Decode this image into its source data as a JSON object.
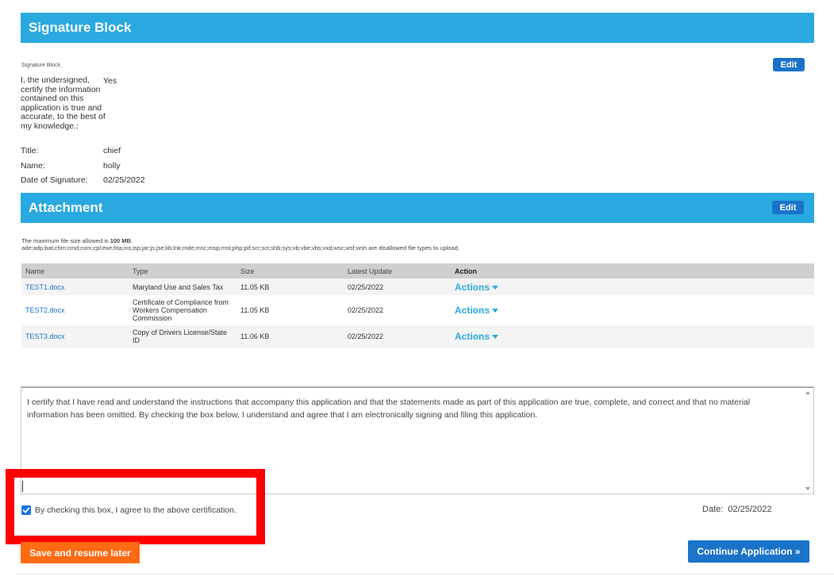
{
  "signature_block": {
    "header": "Signature Block",
    "edit_label": "Edit",
    "small_label": "Signature Block",
    "certify_question": "I, the undersigned, certify the information contained on this application is true and accurate, to the best of my knowledge.:",
    "certify_answer": "Yes",
    "fields": [
      {
        "label": "Title:",
        "value": "chief"
      },
      {
        "label": "Name:",
        "value": "holly"
      },
      {
        "label": "Date of Signature:",
        "value": "02/25/2022"
      }
    ]
  },
  "attachment": {
    "header": "Attachment",
    "edit_label": "Edit",
    "note_prefix": "The maximum file size allowed is ",
    "note_size": "100 MB",
    "note_suffix": ".",
    "disallowed_types": "ade;adp;bat;chm;cmd;com;cpl;exe;hta;ins;isp;jar;js;jse;lib;lnk;mde;msc;msp;mst;php;pif;scr;sct;shb;sys;vb;vbe;vbs;vxd;wsc;wsf;wsh are disallowed file types to upload.",
    "columns": [
      "Name",
      "Type",
      "Size",
      "Latest Update",
      "Action"
    ],
    "rows": [
      {
        "name": "TEST1.docx",
        "type": "Maryland Use and Sales Tax",
        "size": "11.05 KB",
        "updated": "02/25/2022",
        "action": "Actions"
      },
      {
        "name": "TEST2.docx",
        "type": "Certificate of Compliance from Workers Compensation Commission",
        "size": "11.05 KB",
        "updated": "02/25/2022",
        "action": "Actions"
      },
      {
        "name": "TEST3.docx",
        "type": "Copy of Drivers License/State ID",
        "size": "11.06 KB",
        "updated": "02/25/2022",
        "action": "Actions"
      }
    ]
  },
  "certification": {
    "text": "I certify that I have read and understand the instructions that accompany this application and that the statements made as part of this application are true, complete, and correct and that no material information has been omitted. By checking the box below, I understand and agree that I am electronically signing and filing this application.",
    "checkbox_label": "By checking this box, I agree to the above certification.",
    "checked": true,
    "date_label": "Date:",
    "date_value": "02/25/2022"
  },
  "buttons": {
    "save": "Save and resume later",
    "continue": "Continue Application »"
  },
  "colors": {
    "section_header": "#2aa9e0",
    "edit_button": "#1a73c9",
    "save_button": "#ff6a13",
    "continue_button": "#1a73c9",
    "highlight_frame": "#ff0000"
  }
}
